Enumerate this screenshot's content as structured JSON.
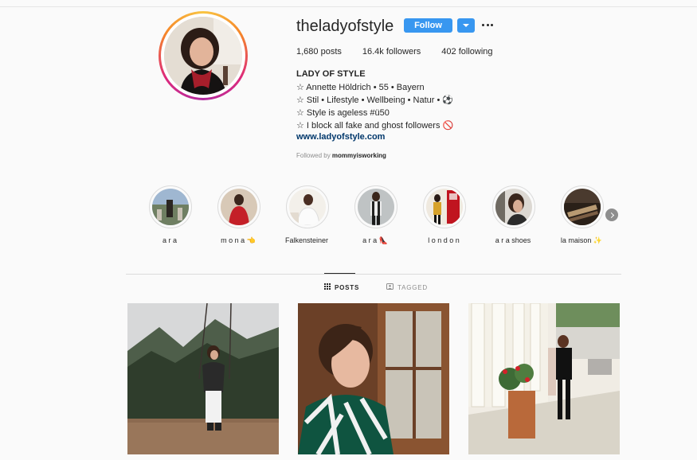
{
  "profile": {
    "username": "theladyofstyle",
    "follow_label": "Follow",
    "stats": {
      "posts": "1,680",
      "posts_label": "posts",
      "followers": "16.4k",
      "followers_label": "followers",
      "following": "402",
      "following_label": "following"
    },
    "full_name": "LADY OF STYLE",
    "bio": [
      "☆ Annette Höldrich • 55 • Bayern",
      "☆ Stil • Lifestyle • Wellbeing • Natur • ⚽",
      "☆ Style is ageless #ü50",
      "☆ I block all fake and ghost followers 🚫"
    ],
    "website": "www.ladyofstyle.com",
    "followed_by_prefix": "Followed by",
    "followed_by_user": "mommyisworking"
  },
  "highlights": [
    {
      "label": "a r a"
    },
    {
      "label": "m o n a 👈"
    },
    {
      "label": "Falkensteiner"
    },
    {
      "label": "a r a 👠"
    },
    {
      "label": "l o n d o n"
    },
    {
      "label": "a r a shoes"
    },
    {
      "label": "la maison ✨"
    }
  ],
  "tabs": [
    {
      "label": "POSTS",
      "active": true
    },
    {
      "label": "TAGGED",
      "active": false
    }
  ],
  "colors": {
    "accent": "#3897f0",
    "background": "#fafafa",
    "text": "#262626",
    "muted": "#8e8e8e",
    "link": "#00376b"
  },
  "icons": {
    "more": "more-horizontal-icon",
    "dropdown": "chevron-down-icon",
    "next": "chevron-right-icon",
    "posts_tab": "grid-icon",
    "tagged_tab": "tag-icon"
  }
}
